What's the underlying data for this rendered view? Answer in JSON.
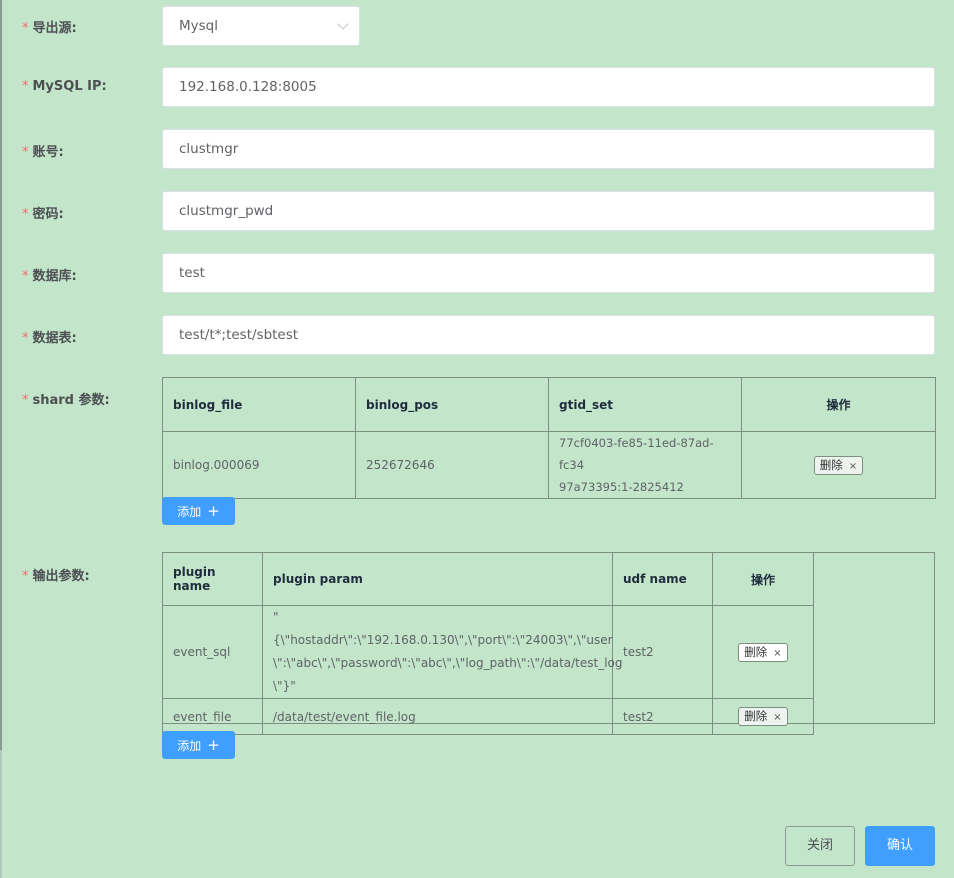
{
  "form": {
    "export_source": {
      "label": "导出源:",
      "value": "Mysql"
    },
    "mysql_ip": {
      "label": "MySQL IP:",
      "value": "192.168.0.128:8005"
    },
    "account": {
      "label": "账号:",
      "value": "clustmgr"
    },
    "password": {
      "label": "密码:",
      "value": "clustmgr_pwd"
    },
    "database": {
      "label": "数据库:",
      "value": "test"
    },
    "tables": {
      "label": "数据表:",
      "value": "test/t*;test/sbtest"
    },
    "required_mark": "*"
  },
  "shard": {
    "label": "shard 参数:",
    "headers": [
      "binlog_file",
      "binlog_pos",
      "gtid_set",
      "操作"
    ],
    "rows": [
      {
        "binlog_file": "binlog.000069",
        "binlog_pos": "252672646",
        "gtid_line1": "77cf0403-fe85-11ed-87ad-fc34",
        "gtid_line2": "97a73395:1-2825412",
        "delete_label": "删除"
      }
    ],
    "add_label": "添加"
  },
  "output": {
    "label": "输出参数:",
    "headers": [
      "plugin name",
      "plugin param",
      "udf name",
      "操作"
    ],
    "rows": [
      {
        "plugin_name": "event_sql",
        "param_line1": "\"{\\\"hostaddr\\\":\\\"192.168.0.130\\\",\\\"port\\\":\\\"24003\\\",\\\"user",
        "param_line2": "\\\":\\\"abc\\\",\\\"password\\\":\\\"abc\\\",\\\"log_path\\\":\\\"/data/test_log",
        "param_line3": "\\\"}\"",
        "udf_name": "test2",
        "delete_label": "删除"
      },
      {
        "plugin_name": "event_file",
        "param_line1": "/data/test/event_file.log",
        "udf_name": "test2",
        "delete_label": "删除"
      }
    ],
    "add_label": "添加"
  },
  "footer": {
    "close_label": "关闭",
    "confirm_label": "确认"
  },
  "icons": {
    "remove": "×",
    "add": "+",
    "dropdown": "chevron-down"
  },
  "colors": {
    "background": "#c3e6cb",
    "primary": "#409eff",
    "required": "#f56c6c"
  }
}
